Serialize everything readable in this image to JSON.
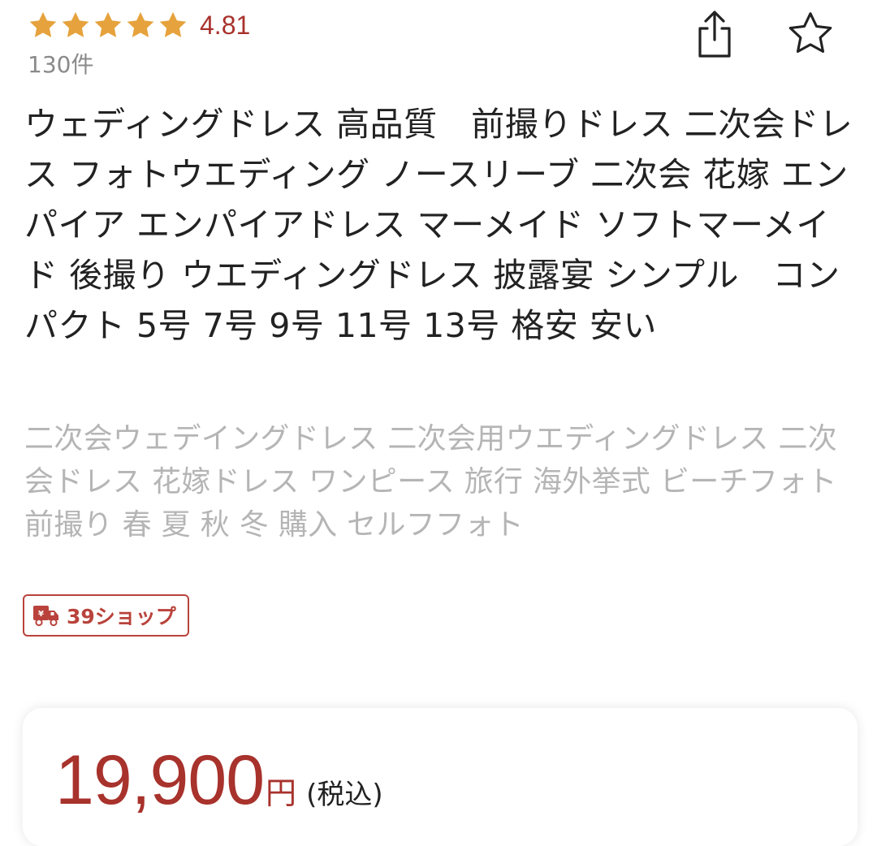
{
  "rating": {
    "stars": 5,
    "value": "4.81",
    "count_label": "130件",
    "star_color": "#e6a23c"
  },
  "actions": {
    "share_icon": "share-icon",
    "favorite_icon": "star-outline-icon"
  },
  "product": {
    "title": "ウェディングドレス 高品質　前撮りドレス 二次会ドレス フォトウエディング ノースリーブ 二次会 花嫁 エンパイア  エンパイアドレス  マーメイド ソフトマーメイド 後撮り ウエディングドレス 披露宴 シンプル　コンパクト 5号 7号 9号 11号 13号 格安 安い",
    "tags": "二次会ウェデイングドレス 二次会用ウエディングドレス 二次会ドレス 花嫁ドレス ワンピース 旅行 海外挙式 ビーチフォト 前撮り 春 夏 秋 冬 購入 セルフフォト"
  },
  "shop": {
    "badge_label": "39ショップ",
    "icon": "delivery-truck-icon",
    "accent_color": "#b9433c"
  },
  "price": {
    "amount": "19,900",
    "currency": "円",
    "tax_label": "(税込)",
    "color": "#a8322c"
  }
}
